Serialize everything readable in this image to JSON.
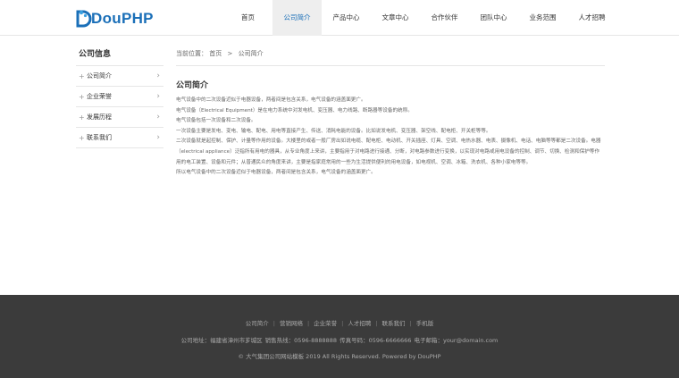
{
  "colors": {
    "accent": "#1a6fb8",
    "footer_bg": "#3b3b3b",
    "nav_active_bg": "#eeeeee"
  },
  "header": {
    "logo_text": "DouPHP",
    "nav": [
      {
        "label": "首页",
        "active": false
      },
      {
        "label": "公司简介",
        "active": true
      },
      {
        "label": "产品中心",
        "active": false
      },
      {
        "label": "文章中心",
        "active": false
      },
      {
        "label": "合作伙伴",
        "active": false
      },
      {
        "label": "团队中心",
        "active": false
      },
      {
        "label": "业务范围",
        "active": false
      },
      {
        "label": "人才招聘",
        "active": false
      }
    ]
  },
  "sidebar": {
    "title": "公司信息",
    "items": [
      {
        "label": "公司简介",
        "icon": "plus-icon",
        "arrow": "chevron-right-icon"
      },
      {
        "label": "企业荣誉",
        "icon": "plus-icon",
        "arrow": "chevron-right-icon"
      },
      {
        "label": "发展历程",
        "icon": "plus-icon",
        "arrow": "chevron-right-icon"
      },
      {
        "label": "联系我们",
        "icon": "plus-icon",
        "arrow": "chevron-right-icon"
      }
    ]
  },
  "breadcrumb": {
    "prefix": "当前位置：",
    "home": "首页",
    "separator": ">",
    "current": "公司简介"
  },
  "main": {
    "title": "公司简介",
    "paragraphs": [
      "电气设备中的二次设备近似于电器设备，两者间是包含关系，电气设备的涵盖面更广。",
      "电气设备（Electrical Equipment）是在电力系统中对发电机、变压器、电力线路、断路器等设备的统称。",
      "电气设备包括一次设备和二次设备。",
      "一次设备主要是发电、变电、输电、配电、用电等直接产生、传送、消耗电能的设备。比如说发电机、变压器、架空线、配电柜、开关柜等等。",
      "二次设备就是起控制、保护、计量等作用的设备。大楼里的或者一般厂房出如说电缆、配电柜、电动机、开关插座、灯具、空调、电热水器、电表、摄像机、电话、电脑等等都是二次设备。电器（electrical appliance）泛指所有用电的器具，从专业角度上来讲，主要指用于对电路进行接通、分断，对电路参数进行变换，以实现对电路或用电设备的控制、调节、切换、检测和保护等作用的电工装置、设备和元件；从普通民众的角度来讲，主要是指家庭常用的一些为生活提供便利的用电设备，如电视机、空调、冰箱、洗衣机、各种小家电等等。",
      "所以电气设备中的二次设备近似于电器设备，两者间是包含关系，电气设备的涵盖面更广。"
    ]
  },
  "footer": {
    "links": [
      "公司简介",
      "营销网络",
      "企业荣誉",
      "人才招聘",
      "联系我们",
      "手机版"
    ],
    "link_separator": "|",
    "contact": "公司地址：福建省漳州市芗城区  销售热线：0596-8888888  传真号码：0596-6666666  电子邮箱：your@domain.com",
    "copyright": "© 大气集团公司网站模板 2019 All Rights Reserved. Powered by DouPHP"
  }
}
